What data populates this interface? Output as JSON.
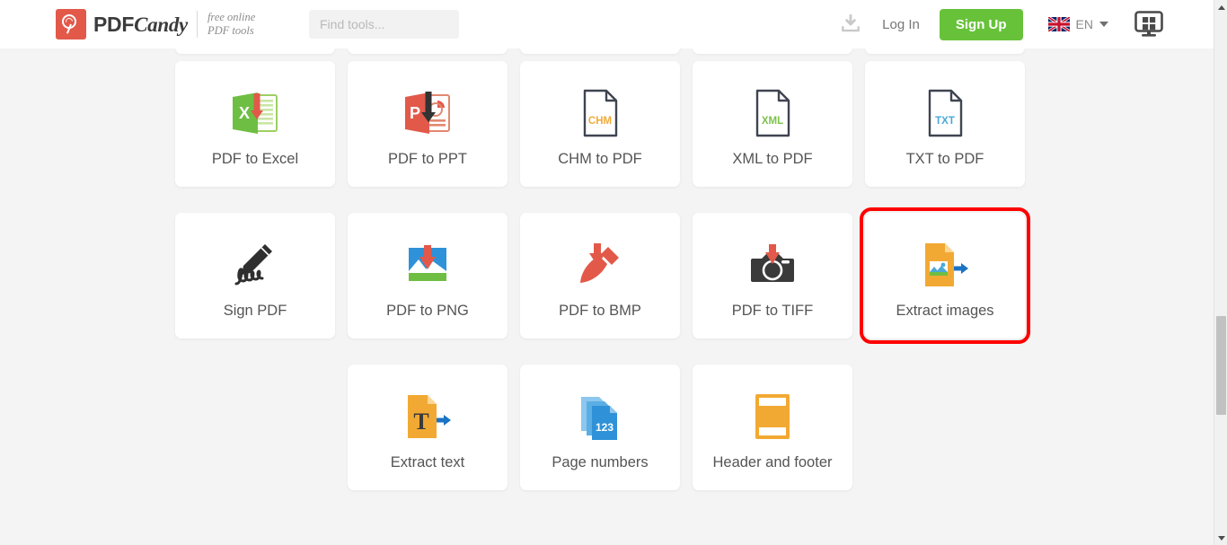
{
  "header": {
    "logo": {
      "icon": "lollipop-icon",
      "brand_primary": "PDF",
      "brand_secondary": "Candy",
      "tagline_line1": "free online",
      "tagline_line2": "PDF tools",
      "mark_color": "#e2594a"
    },
    "search": {
      "placeholder": "Find tools...",
      "value": ""
    },
    "download_icon": "download-icon",
    "login_label": "Log In",
    "signup_label": "Sign Up",
    "signup_color": "#67c23a",
    "language": {
      "flag": "uk-flag-icon",
      "code": "EN",
      "caret": "chevron-down-icon"
    },
    "desktop_app_icon": "desktop-monitor-windows-icon"
  },
  "tools": {
    "row_partial": [
      {
        "label": "",
        "icon": "partial-card"
      },
      {
        "label": "",
        "icon": "partial-card"
      },
      {
        "label": "",
        "icon": "partial-card"
      },
      {
        "label": "",
        "icon": "partial-card"
      },
      {
        "label": "",
        "icon": "partial-card"
      }
    ],
    "row_1": [
      {
        "label": "PDF to Excel",
        "icon": "excel-download-icon",
        "highlighted": false
      },
      {
        "label": "PDF to PPT",
        "icon": "powerpoint-download-icon",
        "highlighted": false
      },
      {
        "label": "CHM to PDF",
        "icon": "chm-file-icon",
        "highlighted": false
      },
      {
        "label": "XML to PDF",
        "icon": "xml-file-icon",
        "highlighted": false
      },
      {
        "label": "TXT to PDF",
        "icon": "txt-file-icon",
        "highlighted": false
      }
    ],
    "row_2": [
      {
        "label": "Sign PDF",
        "icon": "signature-pen-icon",
        "highlighted": false
      },
      {
        "label": "PDF to PNG",
        "icon": "png-image-download-icon",
        "highlighted": false
      },
      {
        "label": "PDF to BMP",
        "icon": "paintbrush-download-icon",
        "highlighted": false
      },
      {
        "label": "PDF to TIFF",
        "icon": "camera-download-icon",
        "highlighted": false
      },
      {
        "label": "Extract images",
        "icon": "extract-images-icon",
        "highlighted": true
      }
    ],
    "row_3": [
      {
        "label": "Extract text",
        "icon": "extract-text-icon",
        "highlighted": false
      },
      {
        "label": "Page numbers",
        "icon": "page-numbers-icon",
        "highlighted": false
      },
      {
        "label": "Header and footer",
        "icon": "header-footer-icon",
        "highlighted": false
      }
    ]
  },
  "highlight_color": "#ff0000",
  "scrollbar": {
    "up_arrow": "caret-up-icon",
    "down_arrow": "caret-down-icon",
    "thumb": "scroll-thumb"
  }
}
